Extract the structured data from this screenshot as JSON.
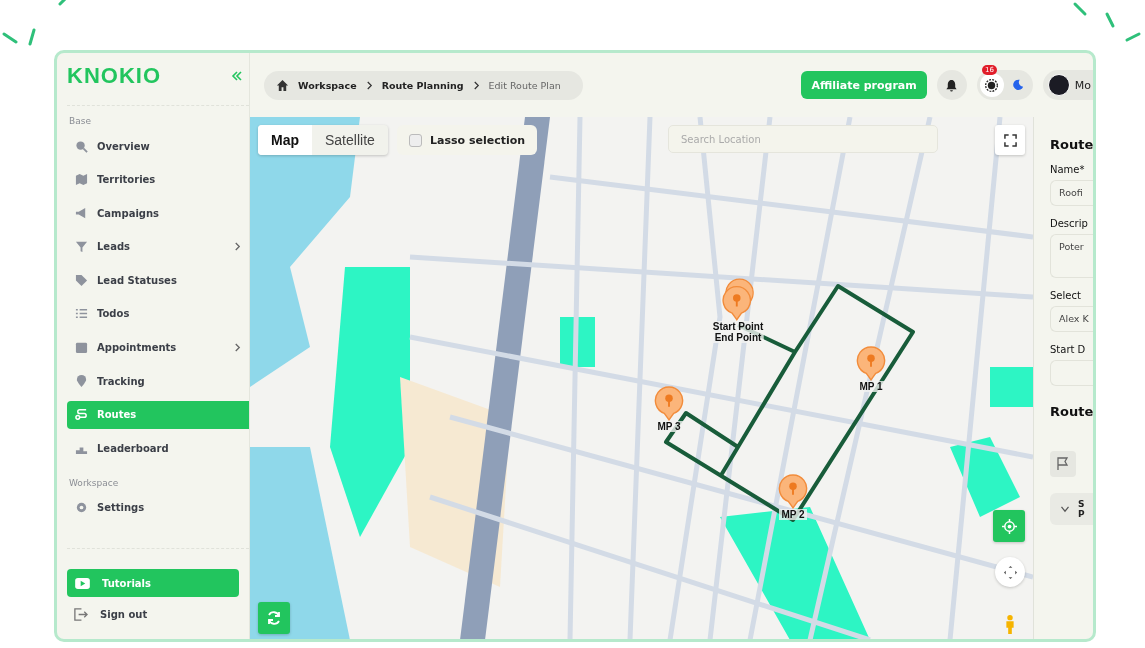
{
  "brand": {
    "name": "KNOKIO"
  },
  "sidebar": {
    "sections": [
      {
        "title": "Base",
        "items": [
          {
            "label": "Overview",
            "selected": false,
            "submenu": false
          },
          {
            "label": "Territories",
            "selected": false,
            "submenu": false
          },
          {
            "label": "Campaigns",
            "selected": false,
            "submenu": false
          },
          {
            "label": "Leads",
            "selected": false,
            "submenu": true
          },
          {
            "label": "Lead Statuses",
            "selected": false,
            "submenu": false
          },
          {
            "label": "Todos",
            "selected": false,
            "submenu": false
          },
          {
            "label": "Appointments",
            "selected": false,
            "submenu": true
          },
          {
            "label": "Tracking",
            "selected": false,
            "submenu": false
          },
          {
            "label": "Routes",
            "selected": true,
            "submenu": false
          },
          {
            "label": "Leaderboard",
            "selected": false,
            "submenu": false
          }
        ]
      },
      {
        "title": "Workspace",
        "items": [
          {
            "label": "Settings",
            "selected": false,
            "submenu": false
          }
        ]
      }
    ],
    "tutorials": "Tutorials",
    "sign_out": "Sign out"
  },
  "breadcrumb": [
    {
      "label": "Workspace",
      "current": false
    },
    {
      "label": "Route Planning",
      "current": false
    },
    {
      "label": "Edit Route Plan",
      "current": true
    }
  ],
  "affiliate_button": "Affiliate program",
  "notifications": {
    "count": "16"
  },
  "theme_toggle": [
    {
      "kind": "sun",
      "selected": true
    },
    {
      "kind": "moon",
      "selected": false
    }
  ],
  "user": {
    "name": "Mo"
  },
  "map": {
    "view_modes": [
      {
        "label": "Map",
        "selected": true
      },
      {
        "label": "Satellite",
        "selected": false
      }
    ],
    "lasso": {
      "label": "Lasso selection",
      "checked": false
    },
    "search": {
      "placeholder": "Search Location"
    },
    "markers": [
      {
        "labels": [
          "Start Point",
          "End Point"
        ]
      },
      {
        "labels": [
          "MP 1"
        ]
      },
      {
        "labels": [
          "MP 2"
        ]
      },
      {
        "labels": [
          "MP 3"
        ]
      }
    ]
  },
  "panel": {
    "title": "Route",
    "fields": [
      {
        "label": "Name*",
        "value": "Roofi",
        "kind": "input"
      },
      {
        "label": "Descrip",
        "value": "Poter",
        "kind": "textarea"
      },
      {
        "label": "Select",
        "value": "Alex K",
        "kind": "input"
      },
      {
        "label": "Start D",
        "kind": "input"
      }
    ],
    "section_title": "Route",
    "stop": {
      "title": "S",
      "subtitle": "P"
    }
  }
}
